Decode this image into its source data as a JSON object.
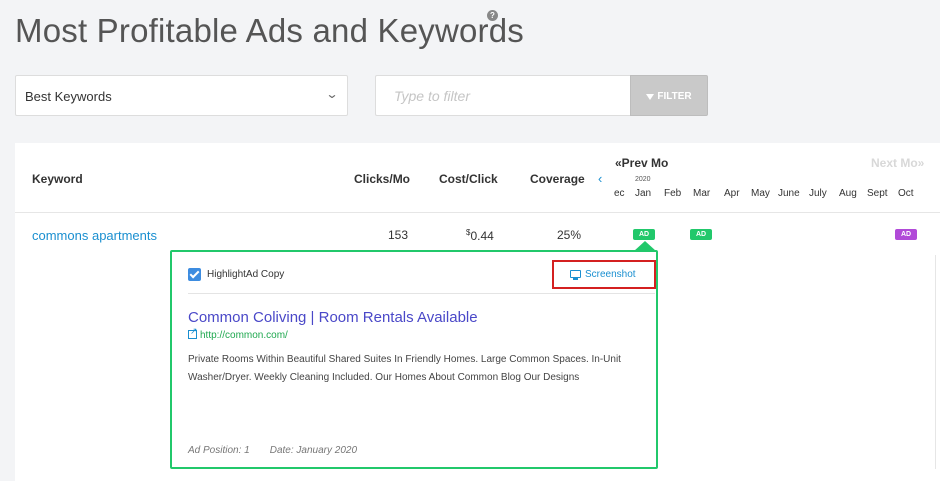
{
  "page": {
    "title": "Most Profitable Ads and Keywords",
    "help_icon": "?"
  },
  "controls": {
    "select_value": "Best Keywords",
    "filter_placeholder": "Type to filter",
    "filter_button": "FILTER"
  },
  "table": {
    "headers": {
      "keyword": "Keyword",
      "clicks": "Clicks/Mo",
      "cost": "Cost/Click",
      "coverage": "Coverage"
    },
    "nav": {
      "prev": "«Prev Mo",
      "next": "Next Mo»",
      "year": "2020"
    },
    "months": [
      "ec",
      "Jan",
      "Feb",
      "Mar",
      "Apr",
      "May",
      "June",
      "July",
      "Aug",
      "Sept",
      "Oct"
    ],
    "rows": [
      {
        "keyword": "commons apartments",
        "clicks": "153",
        "cost_currency": "$",
        "cost": "0.44",
        "coverage": "25%",
        "badges": {
          "jan": "AD",
          "mar": "AD",
          "oct": "AD"
        }
      }
    ]
  },
  "popup": {
    "checkbox_label": "HighlightAd Copy",
    "screenshot_label": "Screenshot",
    "ad_title": "Common Coliving | Room Rentals Available",
    "ad_url": "http://common.com/",
    "ad_description": "Private Rooms Within Beautiful Shared Suites In Friendly Homes. Large Common Spaces. In-Unit Washer/Dryer. Weekly Cleaning Included. Our Homes About Common Blog Our Designs",
    "ad_position": "Ad Position: 1",
    "ad_date": "Date: January 2020"
  },
  "colors": {
    "accent": "#1a8fd0",
    "ad_green": "#21c86b",
    "ad_purple": "#b14ad8",
    "highlight_red": "#d42020",
    "ad_title": "#4a48c8"
  }
}
